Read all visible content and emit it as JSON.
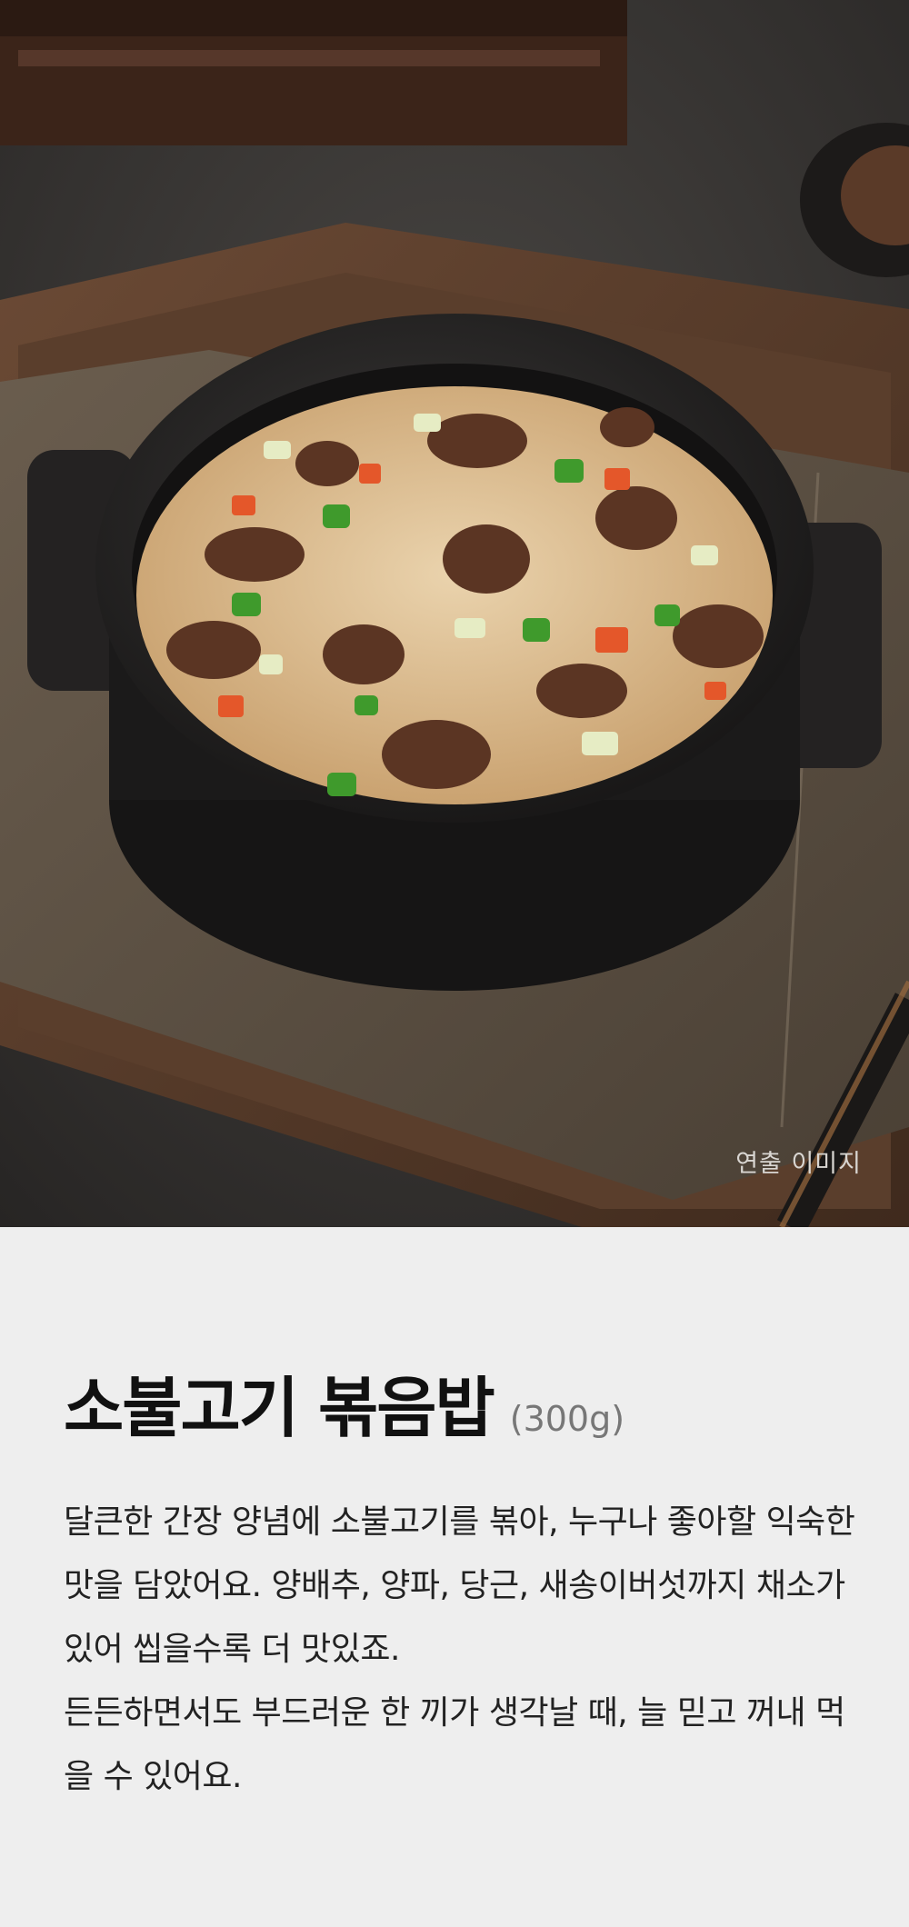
{
  "hero": {
    "image_alt": "뚝배기에 담긴 소불고기 볶음밥",
    "caption": "연출 이미지"
  },
  "product": {
    "name": "소불고기 볶음밥",
    "weight": "(300g)",
    "description_line1": "달큰한 간장 양념에 소불고기를 볶아, 누구나 좋아할 익숙한 맛을 담았어요. 양배추, 양파, 당근, 새송이버섯까지 채소가 있어 씹을수록 더 맛있죠.",
    "description_line2": "든든하면서도 부드러운 한 끼가 생각날 때, 늘 믿고 꺼내 먹을 수 있어요."
  }
}
